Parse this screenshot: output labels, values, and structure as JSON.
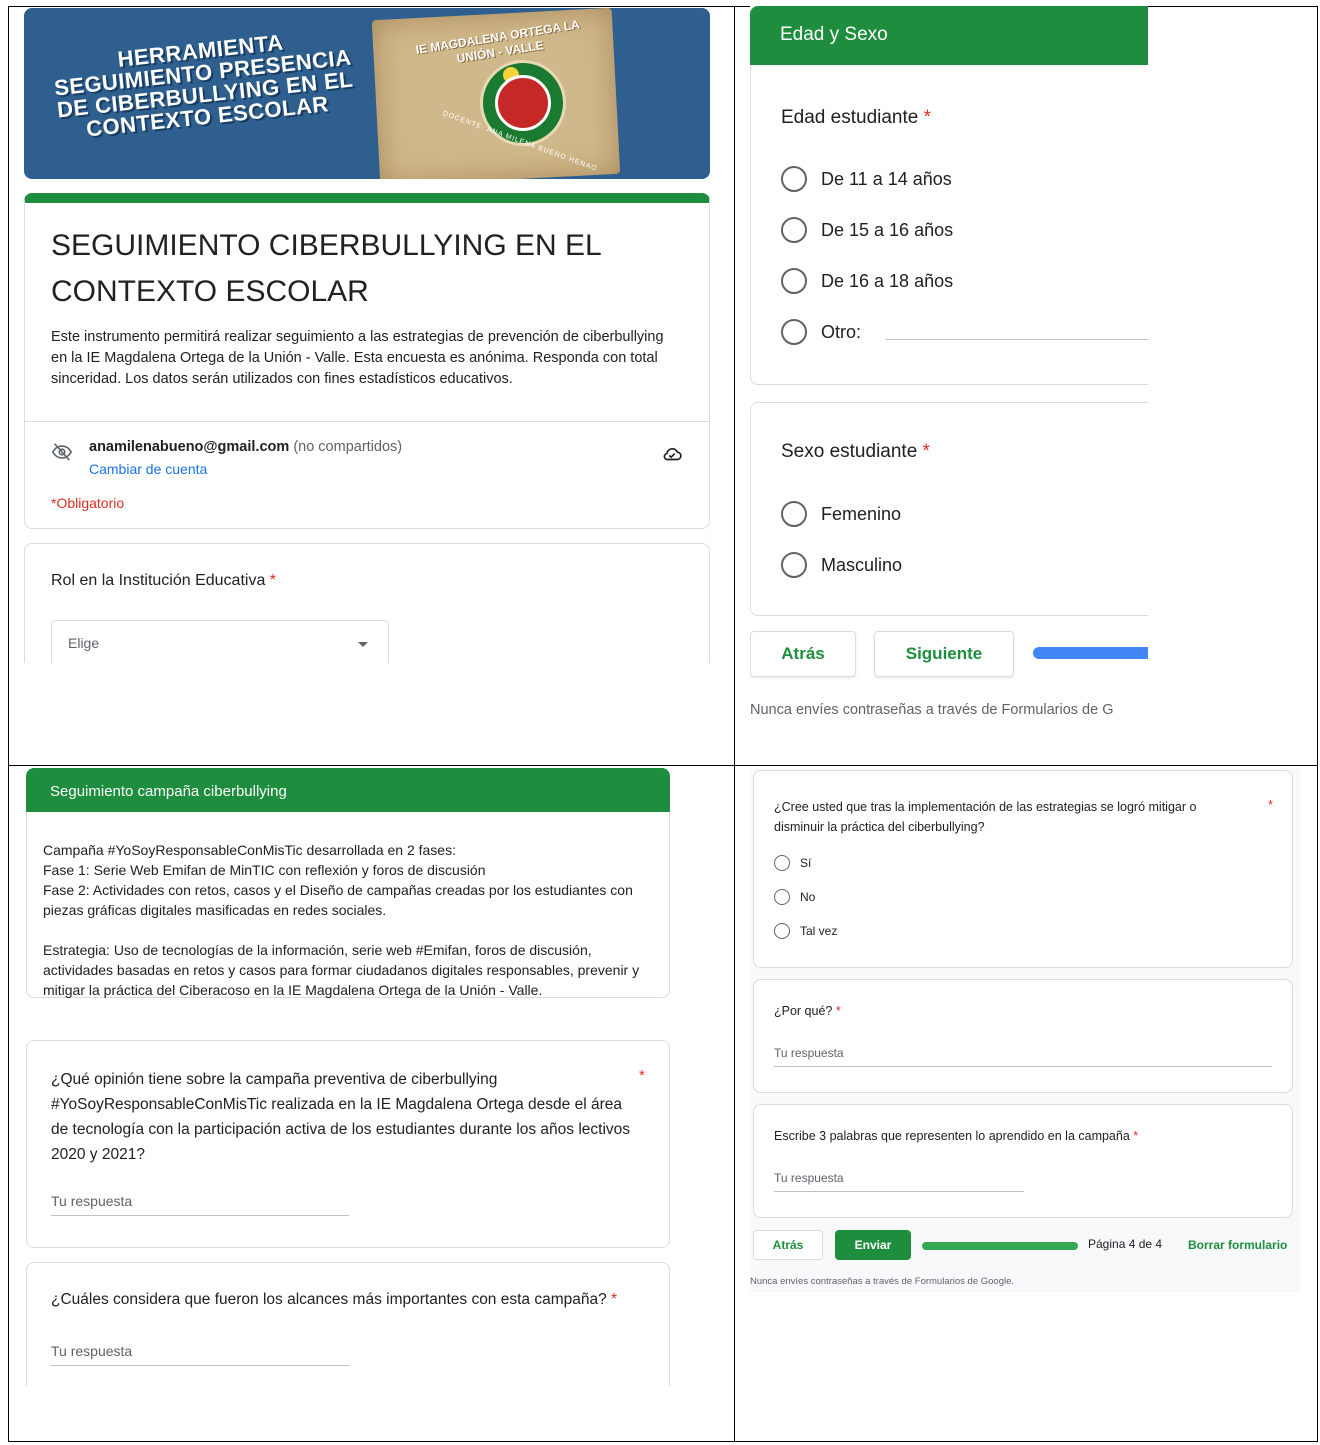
{
  "q1": {
    "banner": {
      "title": "HERRAMIENTA SEGUIMIENTO PRESENCIA DE CIBERBULLYING EN EL CONTEXTO ESCOLAR",
      "institution": "IE MAGDALENA ORTEGA LA UNIÓN - VALLE",
      "subtitle": "DOCENTE: ANA MILENA BUENO HENAO"
    },
    "form": {
      "title": "SEGUIMIENTO CIBERBULLYING EN EL CONTEXTO ESCOLAR",
      "description": "Este instrumento permitirá realizar seguimiento a las estrategias de prevención de ciberbullying en la IE Magdalena Ortega de la Unión - Valle. Esta encuesta es anónima. Responda con total sinceridad. Los datos serán utilizados con fines estadísticos educativos.",
      "email": "anamilenabueno@gmail.com",
      "not_shared": "(no compartidos)",
      "switch_account": "Cambiar de cuenta",
      "required_note": "*Obligatorio"
    },
    "rol": {
      "label": "Rol en la Institución Educativa",
      "select_value": "Elige"
    }
  },
  "q2": {
    "section_title": "Edad y Sexo",
    "edad": {
      "label": "Edad estudiante",
      "options": [
        "De 11 a 14 años",
        "De 15 a 16 años",
        "De 16 a 18 años",
        "Otro:"
      ]
    },
    "sexo": {
      "label": "Sexo estudiante",
      "options": [
        "Femenino",
        "Masculino"
      ]
    },
    "back": "Atrás",
    "next": "Siguiente",
    "footer": "Nunca envíes contraseñas a través de Formularios de G"
  },
  "q3": {
    "section_title": "Seguimiento campaña ciberbullying",
    "campaign_p1": [
      "Campaña #YoSoyResponsableConMisTic desarrollada en 2 fases:",
      "Fase 1: Serie Web Emifan de MinTIC con reflexión y foros de discusión",
      "Fase 2: Actividades con retos, casos y el Diseño de campañas creadas por los estudiantes con piezas gráficas digitales masificadas en redes sociales."
    ],
    "campaign_p2": "Estrategia: Uso de tecnologías de la información, serie web #Emifan, foros de discusión, actividades basadas en retos y casos para formar ciudadanos digitales responsables, prevenir y mitigar la práctica del Ciberacoso en la IE Magdalena Ortega de la Unión - Valle.",
    "opinion_q": "¿Qué opinión tiene sobre la campaña preventiva de ciberbullying #YoSoyResponsableConMisTic realizada  en la IE Magdalena Ortega desde el área de tecnología con la participación activa de los estudiantes durante los años lectivos 2020 y 2021?",
    "alcances_q": "¿Cuáles considera que fueron los alcances más importantes con esta campaña?",
    "answer_placeholder": "Tu respuesta"
  },
  "q4": {
    "mitigar_q": "¿Cree usted que tras la implementación de las estrategias se logró mitigar o disminuir la práctica del ciberbullying?",
    "mitigar_options": [
      "Sí",
      "No",
      "Tal vez"
    ],
    "porque_q": "¿Por qué?",
    "palabras_q": "Escribe 3 palabras que representen lo aprendido en la campaña",
    "answer_placeholder": "Tu respuesta",
    "back": "Atrás",
    "submit": "Enviar",
    "page_indicator": "Página 4 de 4",
    "clear_form": "Borrar formulario",
    "footer": "Nunca envíes contraseñas a través de Formularios de Google."
  },
  "required_mark": "*"
}
